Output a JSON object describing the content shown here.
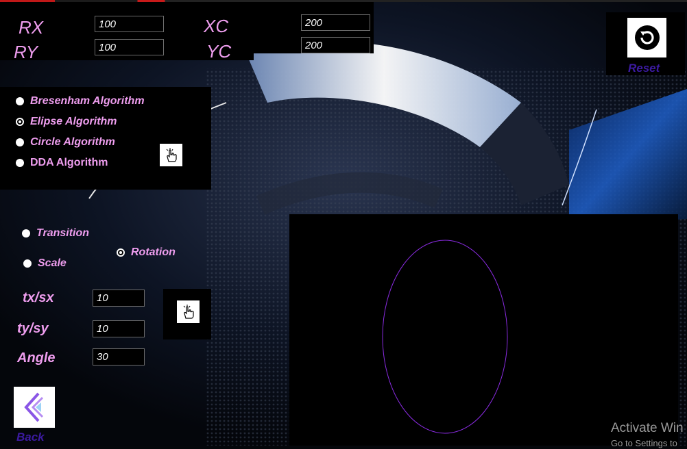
{
  "params": {
    "rx": {
      "label": "RX",
      "value": "100"
    },
    "ry": {
      "label": "RY",
      "value": "100"
    },
    "xc": {
      "label": "XC",
      "value": "200"
    },
    "yc": {
      "label": "YC",
      "value": "200"
    }
  },
  "algorithms": [
    {
      "label": "Bresenham Algorithm",
      "checked": false
    },
    {
      "label": "Elipse Algorithm",
      "checked": true
    },
    {
      "label": "Circle Algorithm",
      "checked": false
    },
    {
      "label": "DDA Algorithm",
      "checked": false
    }
  ],
  "transforms": {
    "transition": {
      "label": "Transition",
      "checked": false
    },
    "scale": {
      "label": "Scale",
      "checked": false
    },
    "rotation": {
      "label": "Rotation",
      "checked": true
    }
  },
  "transform_params": {
    "txsx": {
      "label": "tx/sx",
      "value": "10"
    },
    "tysy": {
      "label": "ty/sy",
      "value": "10"
    },
    "angle": {
      "label": "Angle",
      "value": "30"
    }
  },
  "buttons": {
    "reset_label": "Reset",
    "back_label": "Back"
  },
  "icons": {
    "reset": "refresh-icon",
    "draw": "hand-pointer-icon",
    "apply": "hand-pointer-icon",
    "back": "chevron-left-icon"
  },
  "colors": {
    "label": "#ee9dee",
    "button_caption": "#3b1aa0",
    "ellipse_stroke": "#8a2be2"
  },
  "watermark": {
    "line1": "Activate Win",
    "line2": "Go to Settings to"
  }
}
